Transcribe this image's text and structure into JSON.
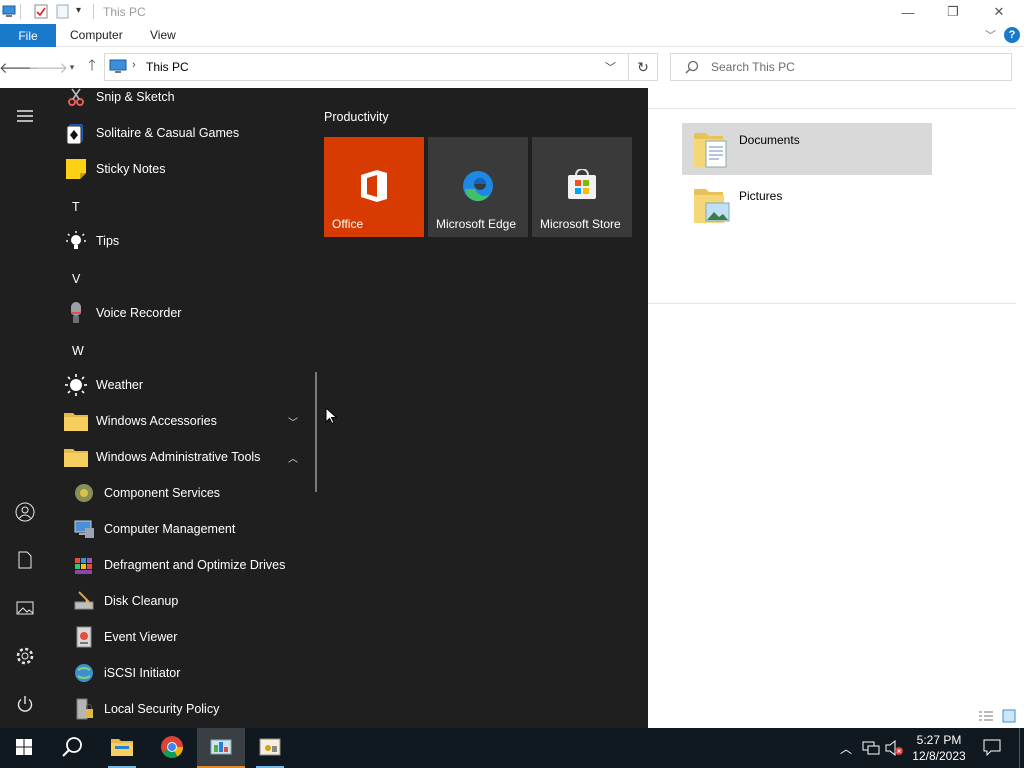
{
  "window": {
    "title": "This PC",
    "ribbon_tabs": [
      "File",
      "Computer",
      "View"
    ],
    "address": "This PC",
    "search_placeholder": "Search This PC",
    "folders": [
      {
        "name": "Documents",
        "selected": true
      },
      {
        "name": "Pictures",
        "selected": false
      }
    ]
  },
  "start_menu": {
    "apps": [
      {
        "kind": "app",
        "label": "Snip & Sketch",
        "icon": "snip-sketch-icon"
      },
      {
        "kind": "app",
        "label": "Solitaire & Casual Games",
        "icon": "solitaire-icon"
      },
      {
        "kind": "app",
        "label": "Sticky Notes",
        "icon": "sticky-notes-icon"
      },
      {
        "kind": "letter",
        "label": "T"
      },
      {
        "kind": "app",
        "label": "Tips",
        "icon": "tips-icon"
      },
      {
        "kind": "letter",
        "label": "V"
      },
      {
        "kind": "app",
        "label": "Voice Recorder",
        "icon": "voice-recorder-icon"
      },
      {
        "kind": "letter",
        "label": "W"
      },
      {
        "kind": "app",
        "label": "Weather",
        "icon": "weather-icon"
      },
      {
        "kind": "folder",
        "label": "Windows Accessories",
        "icon": "folder-icon",
        "expanded": false
      },
      {
        "kind": "folder",
        "label": "Windows Administrative Tools",
        "icon": "folder-icon",
        "expanded": true
      },
      {
        "kind": "sub",
        "label": "Component Services",
        "icon": "component-services-icon"
      },
      {
        "kind": "sub",
        "label": "Computer Management",
        "icon": "computer-management-icon"
      },
      {
        "kind": "sub",
        "label": "Defragment and Optimize Drives",
        "icon": "defragment-icon"
      },
      {
        "kind": "sub",
        "label": "Disk Cleanup",
        "icon": "disk-cleanup-icon"
      },
      {
        "kind": "sub",
        "label": "Event Viewer",
        "icon": "event-viewer-icon"
      },
      {
        "kind": "sub",
        "label": "iSCSI Initiator",
        "icon": "iscsi-initiator-icon"
      },
      {
        "kind": "sub",
        "label": "Local Security Policy",
        "icon": "local-security-policy-icon"
      }
    ],
    "group_title": "Productivity",
    "tiles": [
      {
        "label": "Office",
        "icon": "office-icon",
        "color": "#d83b01"
      },
      {
        "label": "Microsoft Edge",
        "icon": "edge-icon",
        "color": "#3a3a3a"
      },
      {
        "label": "Microsoft Store",
        "icon": "store-icon",
        "color": "#3a3a3a"
      }
    ],
    "rail_icons": [
      "hamburger-icon",
      "user-icon",
      "documents-icon",
      "pictures-icon",
      "settings-icon",
      "power-icon"
    ]
  },
  "taskbar": {
    "items": [
      "start-icon",
      "search-icon",
      "file-explorer-icon",
      "chrome-icon",
      "taskbar-app-icon",
      "taskbar-app2-icon"
    ],
    "time": "5:27 PM",
    "date": "12/8/2023"
  },
  "colors": {
    "accent": "#1979ca",
    "start_bg": "#1f1f1f",
    "taskbar_bg": "#101820",
    "office_tile": "#d83b01",
    "tile_bg": "#3a3a3a"
  }
}
